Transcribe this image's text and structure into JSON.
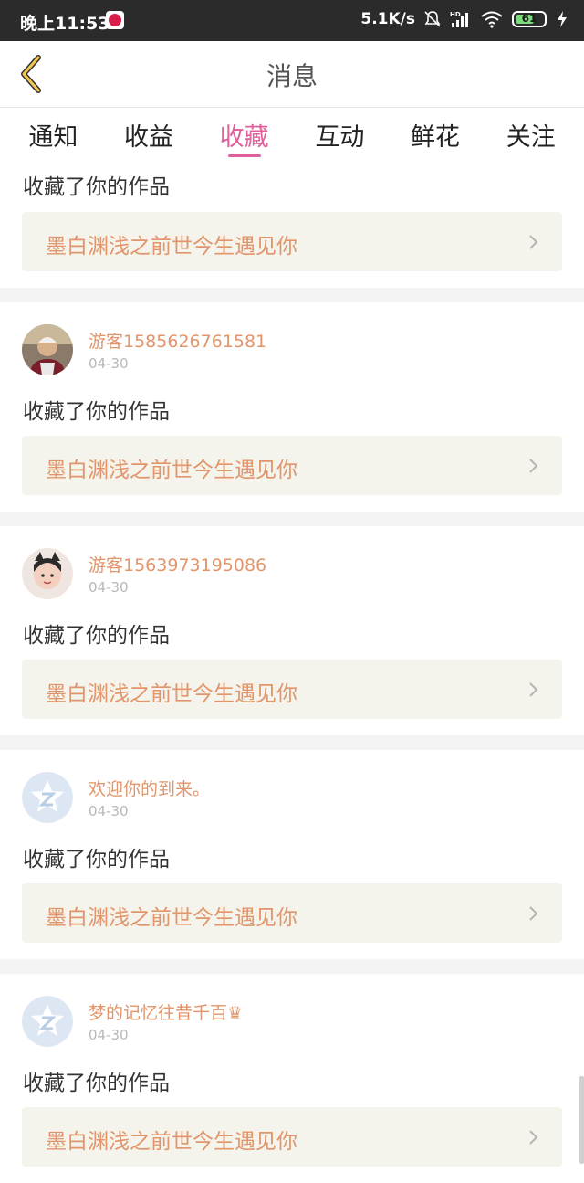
{
  "status_bar": {
    "time": "晚上11:53",
    "network_speed": "5.1K/s",
    "battery": "61"
  },
  "header": {
    "title": "消息",
    "back_icon": "chevron-left-icon"
  },
  "tabs": [
    {
      "label": "通知"
    },
    {
      "label": "收益"
    },
    {
      "label": "收藏"
    },
    {
      "label": "互动"
    },
    {
      "label": "鲜花"
    },
    {
      "label": "关注"
    }
  ],
  "active_tab": "收藏",
  "colors": {
    "accent_pink": "#e0609c",
    "orange_text": "#e2956a",
    "card_bg": "#f4f4ec",
    "status_bar_bg": "#2b2b2b"
  },
  "items": [
    {
      "action": "收藏了你的作品",
      "work_title": "墨白渊浅之前世今生遇见你"
    },
    {
      "user": "游客1585626761581",
      "date": "04-30",
      "action": "收藏了你的作品",
      "work_title": "墨白渊浅之前世今生遇见你",
      "avatar": "photo-elderly-man"
    },
    {
      "user": "游客1563973195086",
      "date": "04-30",
      "action": "收藏了你的作品",
      "work_title": "墨白渊浅之前世今生遇见你",
      "avatar": "photo-child-cat-ears"
    },
    {
      "user": "欢迎你的到来。",
      "date": "04-30",
      "action": "收藏了你的作品",
      "work_title": "墨白渊浅之前世今生遇见你",
      "avatar": "default-avatar-icon"
    },
    {
      "user": "梦的记忆往昔千百♛",
      "date": "04-30",
      "action": "收藏了你的作品",
      "work_title": "墨白渊浅之前世今生遇见你",
      "avatar": "default-avatar-icon"
    }
  ]
}
